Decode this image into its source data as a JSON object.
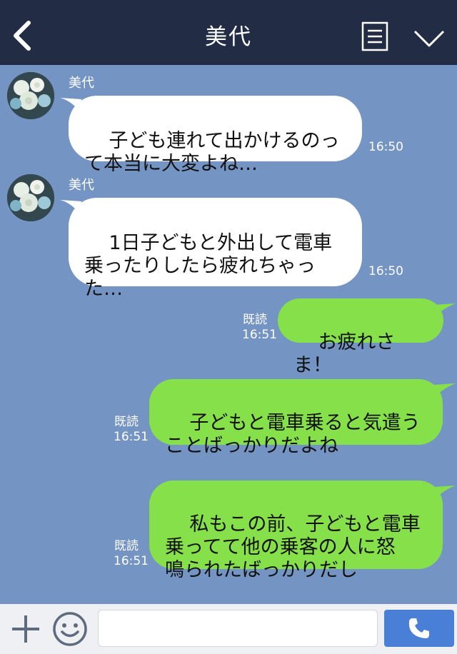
{
  "header": {
    "title": "美代",
    "back_icon": "chevron-left-icon",
    "menu_icon": "note-icon",
    "collapse_icon": "chevron-down-icon"
  },
  "messages": [
    {
      "side": "in",
      "sender": "美代",
      "text": "子ども連れて出かけるのっ\nて本当に大変よね…",
      "time": "16:50"
    },
    {
      "side": "in",
      "sender": "美代",
      "text": "1日子どもと外出して電車\n乗ったりしたら疲れちゃっ\nた…",
      "time": "16:50"
    },
    {
      "side": "out",
      "read": "既読",
      "text": "お疲れさま！",
      "time": "16:51"
    },
    {
      "side": "out",
      "read": "既読",
      "text": "子どもと電車乗ると気遣う\nことばっかりだよね",
      "time": "16:51"
    },
    {
      "side": "out",
      "read": "既読",
      "text": "私もこの前、子どもと電車\n乗ってて他の乗客の人に怒\n鳴られたばっかりだし",
      "time": "16:51"
    }
  ],
  "footer": {
    "plus_icon": "plus-icon",
    "emoji_icon": "smiley-icon",
    "input_value": "",
    "send_icon": "phone-icon"
  },
  "colors": {
    "header_bg": "#222d45",
    "chat_bg": "#7494c4",
    "incoming_bubble": "#ffffff",
    "outgoing_bubble": "#86e04a",
    "send_button": "#4a7fd8"
  }
}
